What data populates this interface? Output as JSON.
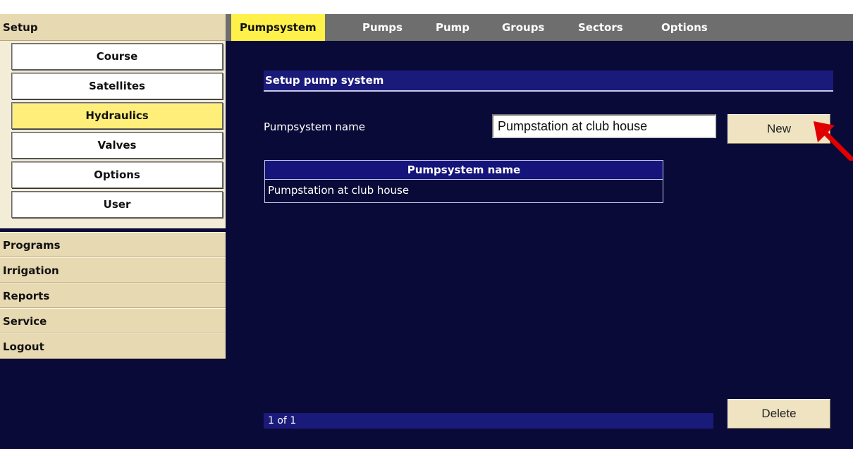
{
  "sidebar": {
    "header": "Setup",
    "subitems": [
      {
        "label": "Course"
      },
      {
        "label": "Satellites"
      },
      {
        "label": "Hydraulics",
        "active": true
      },
      {
        "label": "Valves"
      },
      {
        "label": "Options"
      },
      {
        "label": "User"
      }
    ],
    "menu": [
      {
        "label": "Programs"
      },
      {
        "label": "Irrigation"
      },
      {
        "label": "Reports"
      },
      {
        "label": "Service"
      },
      {
        "label": "Logout"
      }
    ]
  },
  "tabs": [
    {
      "label": "Pumpsystem",
      "active": true
    },
    {
      "label": "Pumps"
    },
    {
      "label": "Pump"
    },
    {
      "label": "Groups"
    },
    {
      "label": "Sectors"
    },
    {
      "label": "Options"
    }
  ],
  "main": {
    "section_title": "Setup pump system",
    "name_label": "Pumpsystem name",
    "name_value": "Pumpstation at club house",
    "new_button": "New",
    "table": {
      "header": "Pumpsystem name",
      "rows": [
        "Pumpstation at club house"
      ]
    },
    "pager": "1 of 1",
    "delete_button": "Delete"
  },
  "icons": {
    "annotation": "red-arrow-icon"
  },
  "colors": {
    "background": "#0a0a38",
    "active_tab": "#fff04a",
    "active_item": "#ffef7a",
    "menu_beige": "#e7d9b2",
    "arrow": "#e00000"
  }
}
